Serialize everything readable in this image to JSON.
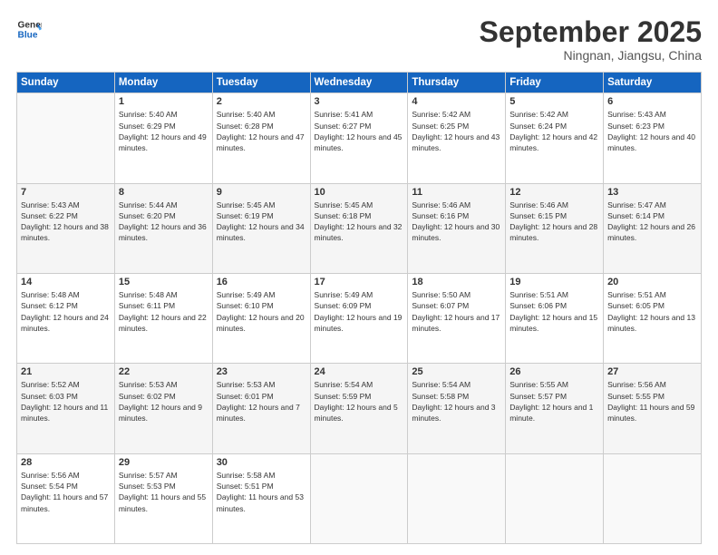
{
  "header": {
    "logo_line1": "General",
    "logo_line2": "Blue",
    "month": "September 2025",
    "location": "Ningnan, Jiangsu, China"
  },
  "weekdays": [
    "Sunday",
    "Monday",
    "Tuesday",
    "Wednesday",
    "Thursday",
    "Friday",
    "Saturday"
  ],
  "weeks": [
    [
      {
        "day": "",
        "empty": true
      },
      {
        "day": "1",
        "sunrise": "5:40 AM",
        "sunset": "6:29 PM",
        "daylight": "12 hours and 49 minutes."
      },
      {
        "day": "2",
        "sunrise": "5:40 AM",
        "sunset": "6:28 PM",
        "daylight": "12 hours and 47 minutes."
      },
      {
        "day": "3",
        "sunrise": "5:41 AM",
        "sunset": "6:27 PM",
        "daylight": "12 hours and 45 minutes."
      },
      {
        "day": "4",
        "sunrise": "5:42 AM",
        "sunset": "6:25 PM",
        "daylight": "12 hours and 43 minutes."
      },
      {
        "day": "5",
        "sunrise": "5:42 AM",
        "sunset": "6:24 PM",
        "daylight": "12 hours and 42 minutes."
      },
      {
        "day": "6",
        "sunrise": "5:43 AM",
        "sunset": "6:23 PM",
        "daylight": "12 hours and 40 minutes."
      }
    ],
    [
      {
        "day": "7",
        "sunrise": "5:43 AM",
        "sunset": "6:22 PM",
        "daylight": "12 hours and 38 minutes."
      },
      {
        "day": "8",
        "sunrise": "5:44 AM",
        "sunset": "6:20 PM",
        "daylight": "12 hours and 36 minutes."
      },
      {
        "day": "9",
        "sunrise": "5:45 AM",
        "sunset": "6:19 PM",
        "daylight": "12 hours and 34 minutes."
      },
      {
        "day": "10",
        "sunrise": "5:45 AM",
        "sunset": "6:18 PM",
        "daylight": "12 hours and 32 minutes."
      },
      {
        "day": "11",
        "sunrise": "5:46 AM",
        "sunset": "6:16 PM",
        "daylight": "12 hours and 30 minutes."
      },
      {
        "day": "12",
        "sunrise": "5:46 AM",
        "sunset": "6:15 PM",
        "daylight": "12 hours and 28 minutes."
      },
      {
        "day": "13",
        "sunrise": "5:47 AM",
        "sunset": "6:14 PM",
        "daylight": "12 hours and 26 minutes."
      }
    ],
    [
      {
        "day": "14",
        "sunrise": "5:48 AM",
        "sunset": "6:12 PM",
        "daylight": "12 hours and 24 minutes."
      },
      {
        "day": "15",
        "sunrise": "5:48 AM",
        "sunset": "6:11 PM",
        "daylight": "12 hours and 22 minutes."
      },
      {
        "day": "16",
        "sunrise": "5:49 AM",
        "sunset": "6:10 PM",
        "daylight": "12 hours and 20 minutes."
      },
      {
        "day": "17",
        "sunrise": "5:49 AM",
        "sunset": "6:09 PM",
        "daylight": "12 hours and 19 minutes."
      },
      {
        "day": "18",
        "sunrise": "5:50 AM",
        "sunset": "6:07 PM",
        "daylight": "12 hours and 17 minutes."
      },
      {
        "day": "19",
        "sunrise": "5:51 AM",
        "sunset": "6:06 PM",
        "daylight": "12 hours and 15 minutes."
      },
      {
        "day": "20",
        "sunrise": "5:51 AM",
        "sunset": "6:05 PM",
        "daylight": "12 hours and 13 minutes."
      }
    ],
    [
      {
        "day": "21",
        "sunrise": "5:52 AM",
        "sunset": "6:03 PM",
        "daylight": "12 hours and 11 minutes."
      },
      {
        "day": "22",
        "sunrise": "5:53 AM",
        "sunset": "6:02 PM",
        "daylight": "12 hours and 9 minutes."
      },
      {
        "day": "23",
        "sunrise": "5:53 AM",
        "sunset": "6:01 PM",
        "daylight": "12 hours and 7 minutes."
      },
      {
        "day": "24",
        "sunrise": "5:54 AM",
        "sunset": "5:59 PM",
        "daylight": "12 hours and 5 minutes."
      },
      {
        "day": "25",
        "sunrise": "5:54 AM",
        "sunset": "5:58 PM",
        "daylight": "12 hours and 3 minutes."
      },
      {
        "day": "26",
        "sunrise": "5:55 AM",
        "sunset": "5:57 PM",
        "daylight": "12 hours and 1 minute."
      },
      {
        "day": "27",
        "sunrise": "5:56 AM",
        "sunset": "5:55 PM",
        "daylight": "11 hours and 59 minutes."
      }
    ],
    [
      {
        "day": "28",
        "sunrise": "5:56 AM",
        "sunset": "5:54 PM",
        "daylight": "11 hours and 57 minutes."
      },
      {
        "day": "29",
        "sunrise": "5:57 AM",
        "sunset": "5:53 PM",
        "daylight": "11 hours and 55 minutes."
      },
      {
        "day": "30",
        "sunrise": "5:58 AM",
        "sunset": "5:51 PM",
        "daylight": "11 hours and 53 minutes."
      },
      {
        "day": "",
        "empty": true
      },
      {
        "day": "",
        "empty": true
      },
      {
        "day": "",
        "empty": true
      },
      {
        "day": "",
        "empty": true
      }
    ]
  ],
  "labels": {
    "sunrise": "Sunrise:",
    "sunset": "Sunset:",
    "daylight": "Daylight:"
  }
}
